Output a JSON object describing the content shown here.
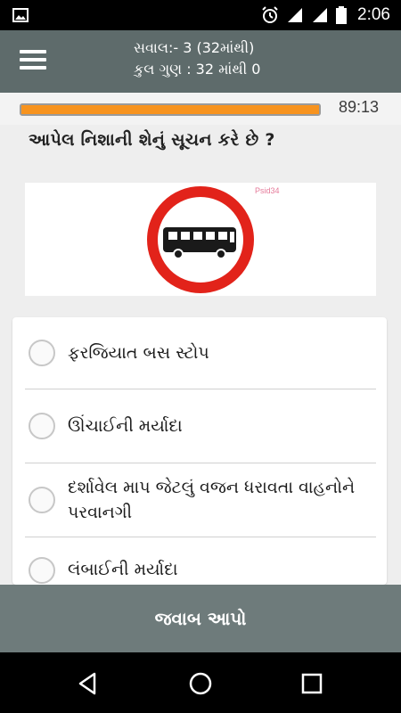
{
  "status_bar": {
    "time": "2:06",
    "icons": [
      "image-icon",
      "alarm-icon",
      "wifi-icon",
      "signal-icon",
      "battery-icon"
    ]
  },
  "header": {
    "question_counter": "સવાલ:- 3 (32માંથી)",
    "total_score": "કુલ ગુણ : 32 માંથી 0"
  },
  "progress": {
    "fraction": 1.0,
    "timer": "89:13",
    "bar_color": "#f7931e"
  },
  "question": {
    "text": "આપેલ નિશાની શેનું સૂચન કરે છે ?"
  },
  "sign": {
    "watermark": "Psid34",
    "icon": "no-bus-sign-icon"
  },
  "options": [
    {
      "label": "ફરજિયાત બસ સ્ટોપ"
    },
    {
      "label": "ઊંચાઈની મર્યાદા"
    },
    {
      "label": "દર્શાવેલ માપ જેટલું વજન ધરાવતા વાહનોને પરવાનગી"
    },
    {
      "label": "લંબાઈની મર્યાદા"
    }
  ],
  "submit": {
    "label": "જવાબ આપો"
  },
  "colors": {
    "header_bg": "#5e6b6b",
    "submit_bg": "#6e7b7b",
    "sign_red": "#e2231a"
  }
}
